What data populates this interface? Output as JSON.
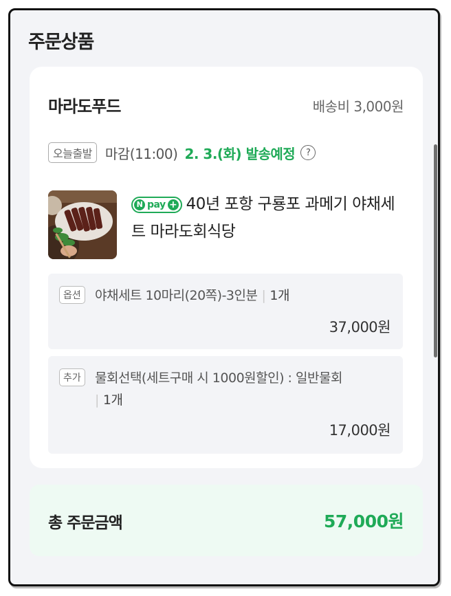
{
  "section_title": "주문상품",
  "seller": {
    "name": "마라도푸드",
    "shipping_fee": "배송비 3,000원"
  },
  "shipping": {
    "badge": "오늘출발",
    "deadline": "마감(11:00)",
    "date": "2. 3.(화) 발송예정",
    "help_icon": "question-circle-icon"
  },
  "product": {
    "npay_badge": {
      "n": "N",
      "pay": "pay",
      "plus": "+"
    },
    "name": "40년 포항 구룡포 과메기 야채세트 마라도회식당"
  },
  "options": [
    {
      "tag": "옵션",
      "text": "야채세트 10마리(20쪽)-3인분",
      "qty": "1개",
      "price": "37,000원"
    },
    {
      "tag": "추가",
      "text": "물회선택(세트구매 시 1000원할인) : 일반물회",
      "qty": "1개",
      "price": "17,000원"
    }
  ],
  "total": {
    "label": "총 주문금액",
    "value": "57,000원"
  },
  "colors": {
    "accent": "#1faa57",
    "background": "#f3f4f7",
    "total_bg": "#eefaf3"
  }
}
